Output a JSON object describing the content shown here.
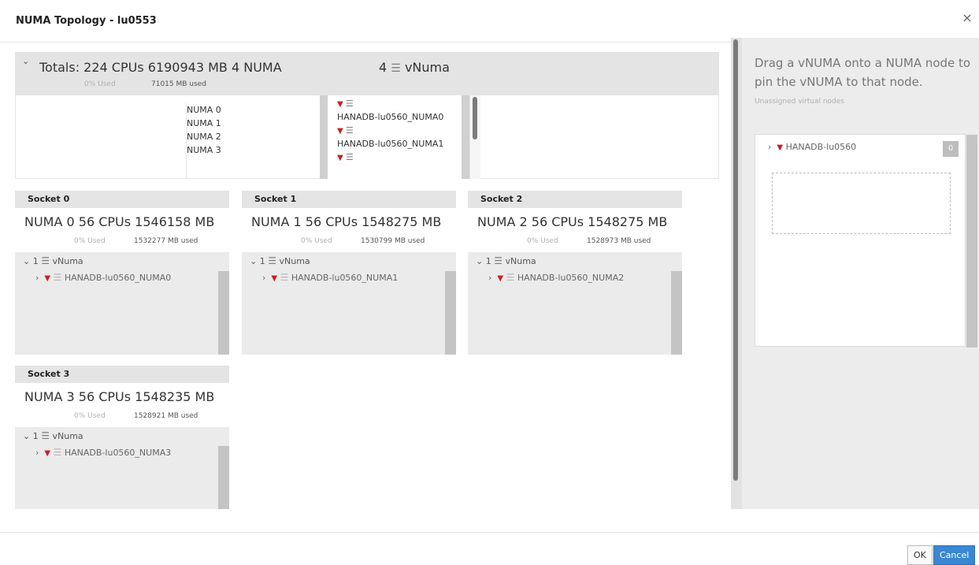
{
  "dialog": {
    "title": "NUMA Topology - lu0553",
    "close_symbol": "×"
  },
  "totals": {
    "summary": "Totals: 224 CPUs  6190943 MB  4 NUMA",
    "used_pct": "0% Used",
    "used_mb": "71015 MB used",
    "vnuma_count": "4",
    "vnuma_label": "vNuma"
  },
  "numa_nodes": [
    "NUMA 0",
    "NUMA 1",
    "NUMA 2",
    "NUMA 3"
  ],
  "vnuma_list": [
    "HANADB-lu0560_NUMA0",
    "HANADB-lu0560_NUMA1"
  ],
  "sockets": [
    {
      "title": "Socket 0",
      "summary": "NUMA 0 56 CPUs  1546158 MB",
      "used_pct": "0% Used",
      "used_mb": "1532277 MB used",
      "vnuma_head": "1",
      "vnuma_label": "vNuma",
      "item": "HANADB-lu0560_NUMA0"
    },
    {
      "title": "Socket 1",
      "summary": "NUMA 1 56 CPUs  1548275 MB",
      "used_pct": "0% Used",
      "used_mb": "1530799 MB used",
      "vnuma_head": "1",
      "vnuma_label": "vNuma",
      "item": "HANADB-lu0560_NUMA1"
    },
    {
      "title": "Socket 2",
      "summary": "NUMA 2 56 CPUs  1548275 MB",
      "used_pct": "0% Used",
      "used_mb": "1528973 MB used",
      "vnuma_head": "1",
      "vnuma_label": "vNuma",
      "item": "HANADB-lu0560_NUMA2"
    },
    {
      "title": "Socket 3",
      "summary": "NUMA 3 56 CPUs  1548235 MB",
      "used_pct": "0% Used",
      "used_mb": "1528921 MB used",
      "vnuma_head": "1",
      "vnuma_label": "vNuma",
      "item": "HANADB-lu0560_NUMA3"
    }
  ],
  "right_pane": {
    "hint": "Drag a vNUMA onto a NUMA node to pin the vNUMA to that node.",
    "sub": "Unassigned virtual nodes",
    "vm_name": "HANADB-lu0560",
    "count": "0"
  },
  "footer": {
    "ok_label": "OK",
    "cancel_label": "Cancel"
  },
  "colors": {
    "accent": "#3a87d4",
    "red_marker": "#cc1f1f",
    "panel_grey": "#e4e4e4"
  },
  "icons": [
    "close-icon",
    "chevron-down-icon",
    "chevron-right-icon",
    "vnuma-stack-icon",
    "red-triangle-icon"
  ]
}
